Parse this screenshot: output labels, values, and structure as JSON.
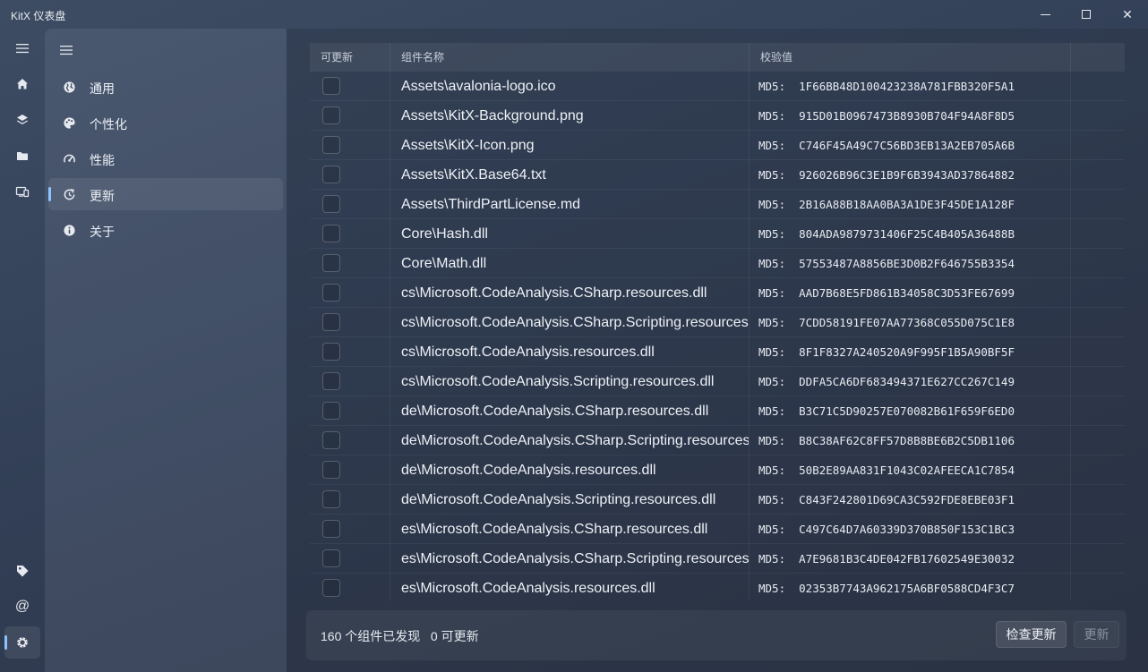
{
  "window": {
    "title": "KitX 仪表盘",
    "minimize_icon": "minimize-icon",
    "maximize_icon": "maximize-icon",
    "close_icon": "close-icon",
    "close_glyph": "✕"
  },
  "rail": {
    "items": [
      {
        "name": "menu",
        "icon": "hamburger-icon"
      },
      {
        "name": "home",
        "icon": "home-icon"
      },
      {
        "name": "layers",
        "icon": "layers-icon"
      },
      {
        "name": "folder",
        "icon": "folder-icon"
      },
      {
        "name": "devices",
        "icon": "devices-icon"
      },
      {
        "name": "tag",
        "icon": "tag-icon"
      },
      {
        "name": "at",
        "icon": "at-icon",
        "glyph": "@"
      },
      {
        "name": "settings",
        "icon": "gear-icon",
        "active": true
      }
    ]
  },
  "nav": {
    "items": [
      {
        "label": "通用",
        "icon": "globe-icon"
      },
      {
        "label": "个性化",
        "icon": "palette-icon"
      },
      {
        "label": "性能",
        "icon": "gauge-icon"
      },
      {
        "label": "更新",
        "icon": "update-icon",
        "active": true
      },
      {
        "label": "关于",
        "icon": "info-icon"
      }
    ]
  },
  "table": {
    "columns": [
      "可更新",
      "组件名称",
      "校验值"
    ],
    "rows": [
      {
        "name": "Assets\\avalonia-logo.ico",
        "hash": "MD5:  1F66BB48D100423238A781FBB320F5A1"
      },
      {
        "name": "Assets\\KitX-Background.png",
        "hash": "MD5:  915D01B0967473B8930B704F94A8F8D5"
      },
      {
        "name": "Assets\\KitX-Icon.png",
        "hash": "MD5:  C746F45A49C7C56BD3EB13A2EB705A6B"
      },
      {
        "name": "Assets\\KitX.Base64.txt",
        "hash": "MD5:  926026B96C3E1B9F6B3943AD37864882"
      },
      {
        "name": "Assets\\ThirdPartLicense.md",
        "hash": "MD5:  2B16A88B18AA0BA3A1DE3F45DE1A128F"
      },
      {
        "name": "Core\\Hash.dll",
        "hash": "MD5:  804ADA9879731406F25C4B405A36488B"
      },
      {
        "name": "Core\\Math.dll",
        "hash": "MD5:  57553487A8856BE3D0B2F646755B3354"
      },
      {
        "name": "cs\\Microsoft.CodeAnalysis.CSharp.resources.dll",
        "hash": "MD5:  AAD7B68E5FD861B34058C3D53FE67699"
      },
      {
        "name": "cs\\Microsoft.CodeAnalysis.CSharp.Scripting.resources.dll",
        "hash": "MD5:  7CDD58191FE07AA77368C055D075C1E8"
      },
      {
        "name": "cs\\Microsoft.CodeAnalysis.resources.dll",
        "hash": "MD5:  8F1F8327A240520A9F995F1B5A90BF5F"
      },
      {
        "name": "cs\\Microsoft.CodeAnalysis.Scripting.resources.dll",
        "hash": "MD5:  DDFA5CA6DF683494371E627CC267C149"
      },
      {
        "name": "de\\Microsoft.CodeAnalysis.CSharp.resources.dll",
        "hash": "MD5:  B3C71C5D90257E070082B61F659F6ED0"
      },
      {
        "name": "de\\Microsoft.CodeAnalysis.CSharp.Scripting.resources.dll",
        "hash": "MD5:  B8C38AF62C8FF57D8B8BE6B2C5DB1106"
      },
      {
        "name": "de\\Microsoft.CodeAnalysis.resources.dll",
        "hash": "MD5:  50B2E89AA831F1043C02AFEECA1C7854"
      },
      {
        "name": "de\\Microsoft.CodeAnalysis.Scripting.resources.dll",
        "hash": "MD5:  C843F242801D69CA3C592FDE8EBE03F1"
      },
      {
        "name": "es\\Microsoft.CodeAnalysis.CSharp.resources.dll",
        "hash": "MD5:  C497C64D7A60339D370B850F153C1BC3"
      },
      {
        "name": "es\\Microsoft.CodeAnalysis.CSharp.Scripting.resources.dll",
        "hash": "MD5:  A7E9681B3C4DE042FB17602549E30032"
      },
      {
        "name": "es\\Microsoft.CodeAnalysis.resources.dll",
        "hash": "MD5:  02353B7743A962175A6BF0588CD4F3C7"
      }
    ]
  },
  "footer": {
    "status": "160 个组件已发现   0 可更新",
    "check_button": "检查更新",
    "update_button": "更新"
  },
  "colors": {
    "accent": "#8fc3ff",
    "background": "#34425a"
  }
}
